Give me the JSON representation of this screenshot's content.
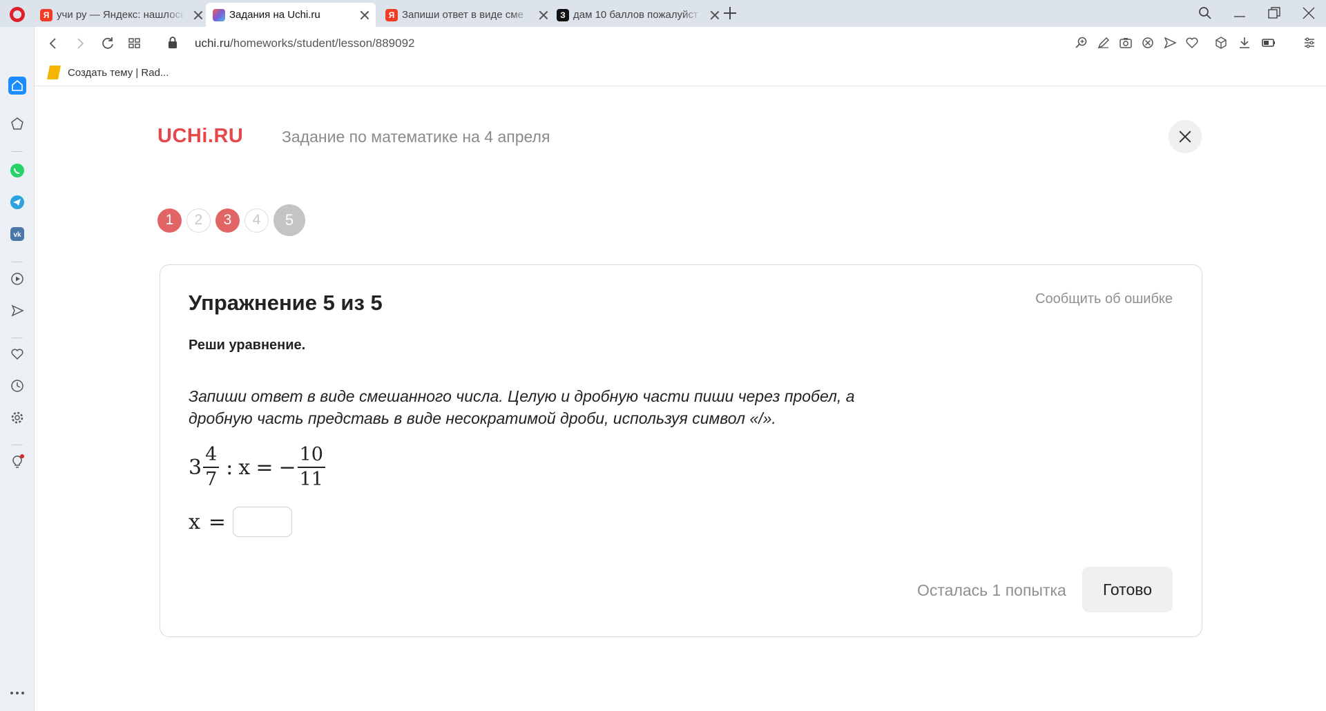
{
  "browser": {
    "tabs": [
      {
        "title": "учи ру — Яндекс: нашлось",
        "favicon": "yandex-favicon",
        "active": false
      },
      {
        "title": "Задания на Uchi.ru",
        "favicon": "uchi-favicon",
        "active": true
      },
      {
        "title": "Запиши ответ в виде сме",
        "favicon": "yandex-favicon",
        "active": false
      },
      {
        "title": "дам 10 баллов пожалуйст",
        "favicon": "znanija-favicon",
        "active": false
      }
    ],
    "url_host": "uchi.ru",
    "url_path": "/homeworks/student/lesson/889092",
    "bookmark": "Создать тему | Rad..."
  },
  "page": {
    "logo": "UCHi.RU",
    "lesson_title": "Задание по математике на 4 апреля",
    "steps": [
      {
        "label": "1",
        "state": "wrong"
      },
      {
        "label": "2",
        "state": "empty"
      },
      {
        "label": "3",
        "state": "wrong"
      },
      {
        "label": "4",
        "state": "empty"
      },
      {
        "label": "5",
        "state": "current"
      }
    ],
    "exercise_title": "Упражнение 5 из 5",
    "report_link": "Сообщить об ошибке",
    "instruction": "Реши уравнение.",
    "hint": "Запиши ответ в виде смешанного числа. Целую и дробную части пиши через пробел, а дробную часть представь в виде несократимой дроби, используя символ «/».",
    "equation": {
      "whole": "3",
      "num1": "4",
      "den1": "7",
      "colon": ":",
      "var": "x",
      "eq": "=",
      "minus": "−",
      "num2": "10",
      "den2": "11"
    },
    "answer_label": "x",
    "answer_eq": "=",
    "answer_value": "",
    "attempts": "Осталась 1 попытка",
    "done_button": "Готово"
  },
  "colors": {
    "brand": "#e6484a",
    "wrong_step": "#e26565",
    "current_step": "#c4c4c4",
    "sidebar_active": "#1a8cff"
  }
}
